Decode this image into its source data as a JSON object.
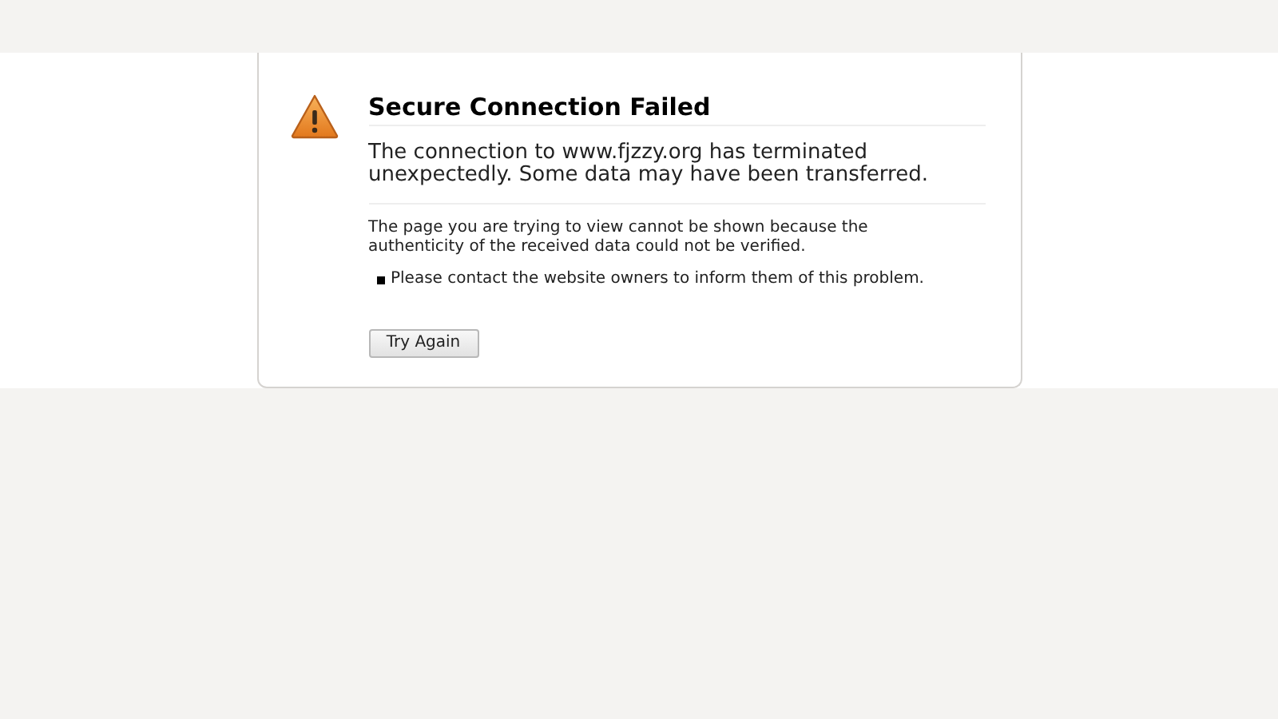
{
  "title": "Secure Connection Failed",
  "intro": "The connection to www.fjzzy.org has terminated unexpectedly. Some data may have been transferred.",
  "description": "The page you are trying to view cannot be shown because the authenticity of the received data could not be verified.",
  "bullets": [
    "Please contact the website owners to inform them of this problem."
  ],
  "button": "Try Again"
}
